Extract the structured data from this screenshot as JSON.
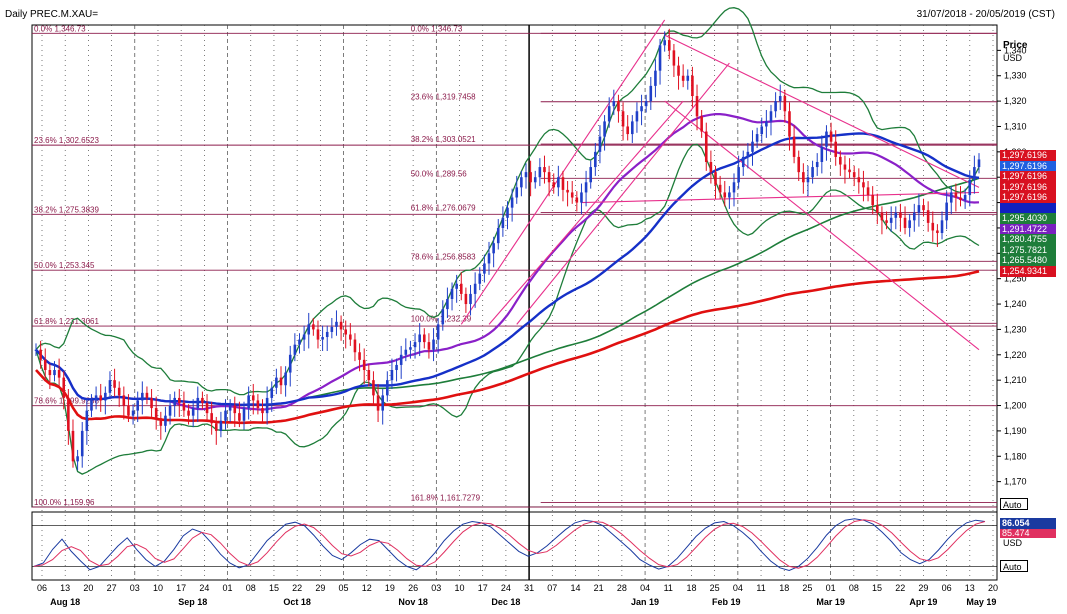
{
  "header": {
    "title": "Daily PREC.M.XAU=",
    "date_range": "31/07/2018 - 20/05/2019 (CST)"
  },
  "axis": {
    "price_label": "Price",
    "unit_label": "USD",
    "osc_unit_label": "USD",
    "auto_label_main": "Auto",
    "auto_label_osc": "Auto"
  },
  "colors": {
    "up_candle": "#1f3fc8",
    "down_candle": "#e01020",
    "fib_line": "#8b1a4a",
    "ma_red": "#e01010",
    "ma_blue": "#1530c8",
    "ma_green": "#1e7d3a",
    "ma_purple": "#8a20c8",
    "trendline": "#e8308c",
    "osc_blue": "#1a3aa0",
    "osc_red": "#e03060"
  },
  "chart_data": {
    "type": "candlestick",
    "instrument": "PREC.M.XAU=",
    "ylim": [
      1160,
      1350
    ],
    "y_ticks": [
      1170,
      1180,
      1190,
      1200,
      1210,
      1220,
      1230,
      1240,
      1250,
      1260,
      1270,
      1280,
      1290,
      1300,
      1310,
      1320,
      1330,
      1340
    ],
    "x_day_labels": [
      "06",
      "13",
      "20",
      "27",
      "03",
      "10",
      "17",
      "24",
      "01",
      "08",
      "15",
      "22",
      "29",
      "05",
      "12",
      "19",
      "26",
      "03",
      "10",
      "17",
      "24",
      "31",
      "07",
      "14",
      "21",
      "28",
      "04",
      "11",
      "18",
      "25",
      "04",
      "11",
      "18",
      "25",
      "01",
      "08",
      "15",
      "22",
      "29",
      "06",
      "13",
      "20"
    ],
    "x_month_labels": [
      "Aug 18",
      "Sep 18",
      "Oct 18",
      "Nov 18",
      "Dec 18",
      "Jan 19",
      "Feb 19",
      "Mar 19",
      "Apr 19",
      "May 19"
    ],
    "fib_left": [
      {
        "pct": "0.0%",
        "price": "1,346.73",
        "value": 1346.73
      },
      {
        "pct": "23.6%",
        "price": "1,302.6523",
        "value": 1302.65
      },
      {
        "pct": "38.2%",
        "price": "1,275.3839",
        "value": 1275.38
      },
      {
        "pct": "50.0%",
        "price": "1,253.345",
        "value": 1253.35
      },
      {
        "pct": "61.8%",
        "price": "1,231.3061",
        "value": 1231.31
      },
      {
        "pct": "78.6%",
        "price": "1,199.9288",
        "value": 1199.93
      },
      {
        "pct": "100.0%",
        "price": "1,159.96",
        "value": 1159.96
      }
    ],
    "fib_right": [
      {
        "pct": "0.0%",
        "price": "1,346.73",
        "value": 1346.73
      },
      {
        "pct": "23.6%",
        "price": "1,319.7458",
        "value": 1319.75
      },
      {
        "pct": "38.2%",
        "price": "1,303.0521",
        "value": 1303.05
      },
      {
        "pct": "50.0%",
        "price": "1,289.56",
        "value": 1289.56
      },
      {
        "pct": "61.8%",
        "price": "1,276.0679",
        "value": 1276.07
      },
      {
        "pct": "78.6%",
        "price": "1,256.8583",
        "value": 1256.86
      },
      {
        "pct": "100.0%",
        "price": "1,232.39",
        "value": 1232.39
      },
      {
        "pct": "161.8%",
        "price": "1,161.7279",
        "value": 1161.73
      }
    ],
    "price_tags": [
      {
        "label": "1,297.6196",
        "value": 1297.62,
        "color": "#d81020"
      },
      {
        "label": "1,297.6196",
        "value": 1294.4,
        "color": "#2060e0"
      },
      {
        "label": "1,297.6196",
        "value": 1291.2,
        "color": "#d81020"
      },
      {
        "label": "1,297.6196",
        "value": 1288.0,
        "color": "#d81020"
      },
      {
        "label": "1,297.6196",
        "value": 1284.8,
        "color": "#d81020"
      },
      {
        "label": "",
        "value": 1278.5,
        "color": "#1020c0"
      },
      {
        "label": "1,295.4030",
        "value": 1275.0,
        "color": "#1e7d3a"
      },
      {
        "label": "1,291.4722",
        "value": 1271.3,
        "color": "#7a20c0"
      },
      {
        "label": "1,280.4755",
        "value": 1267.7,
        "color": "#1e7d3a"
      },
      {
        "label": "1,275.7821",
        "value": 1264.1,
        "color": "#1e7d3a"
      },
      {
        "label": "1,265.5480",
        "value": 1260.5,
        "color": "#1e7d3a"
      },
      {
        "label": "1,254.9341",
        "value": 1256.9,
        "color": "#d81020"
      }
    ],
    "close_series": [
      1222,
      1218,
      1214,
      1212,
      1214,
      1211,
      1203,
      1190,
      1178,
      1180,
      1190,
      1198,
      1202,
      1204,
      1202,
      1205,
      1210,
      1207,
      1204,
      1200,
      1196,
      1198,
      1202,
      1205,
      1203,
      1199,
      1195,
      1192,
      1196,
      1200,
      1203,
      1201,
      1198,
      1196,
      1199,
      1203,
      1201,
      1197,
      1193,
      1190,
      1194,
      1198,
      1200,
      1197,
      1194,
      1199,
      1204,
      1202,
      1199,
      1197,
      1203,
      1207,
      1211,
      1208,
      1213,
      1220,
      1224,
      1226,
      1228,
      1232,
      1230,
      1226,
      1227,
      1229,
      1231,
      1233,
      1230,
      1228,
      1226,
      1221,
      1218,
      1214,
      1210,
      1204,
      1198,
      1204,
      1210,
      1214,
      1216,
      1220,
      1222,
      1223,
      1225,
      1228,
      1225,
      1222,
      1226,
      1232,
      1238,
      1242,
      1246,
      1248,
      1244,
      1240,
      1244,
      1248,
      1252,
      1256,
      1260,
      1264,
      1270,
      1274,
      1278,
      1282,
      1286,
      1290,
      1292,
      1288,
      1290,
      1294,
      1292,
      1288,
      1286,
      1290,
      1285,
      1284,
      1282,
      1280,
      1284,
      1288,
      1294,
      1300,
      1306,
      1312,
      1318,
      1320,
      1316,
      1310,
      1307,
      1312,
      1316,
      1318,
      1320,
      1326,
      1332,
      1342,
      1344,
      1340,
      1334,
      1330,
      1328,
      1330,
      1322,
      1314,
      1308,
      1296,
      1292,
      1287,
      1284,
      1282,
      1284,
      1288,
      1294,
      1298,
      1300,
      1304,
      1307,
      1310,
      1312,
      1316,
      1320,
      1322,
      1316,
      1306,
      1298,
      1292,
      1288,
      1290,
      1294,
      1296,
      1302,
      1308,
      1304,
      1298,
      1295,
      1293,
      1292,
      1290,
      1288,
      1286,
      1283,
      1279,
      1276,
      1273,
      1272,
      1274,
      1276,
      1274,
      1270,
      1273,
      1276,
      1279,
      1277,
      1272,
      1269,
      1268,
      1273,
      1280,
      1284,
      1282,
      1281,
      1283,
      1289,
      1294,
      1297
    ],
    "oscillator": {
      "name": "Stochastic",
      "ylim": [
        0,
        100
      ],
      "levels": [
        80,
        20
      ],
      "last_k": 86.054,
      "last_label": "86.054",
      "last_label_2": "85.474",
      "k_values": [
        20,
        25,
        45,
        60,
        42,
        28,
        15,
        20,
        35,
        50,
        62,
        45,
        30,
        20,
        28,
        45,
        65,
        75,
        70,
        55,
        38,
        25,
        18,
        22,
        40,
        58,
        70,
        82,
        85,
        80,
        66,
        50,
        36,
        30,
        40,
        52,
        60,
        58,
        44,
        30,
        20,
        15,
        25,
        40,
        58,
        72,
        82,
        86,
        84,
        78,
        66,
        54,
        42,
        35,
        40,
        50,
        62,
        74,
        84,
        88,
        86,
        80,
        68,
        56,
        44,
        30,
        22,
        16,
        20,
        32,
        48,
        64,
        76,
        84,
        86,
        80,
        70,
        58,
        42,
        28,
        18,
        14,
        20,
        32,
        48,
        66,
        80,
        88,
        90,
        88,
        82,
        70,
        56,
        40,
        30,
        24,
        30,
        44,
        60,
        74,
        84,
        88,
        86
      ]
    }
  }
}
